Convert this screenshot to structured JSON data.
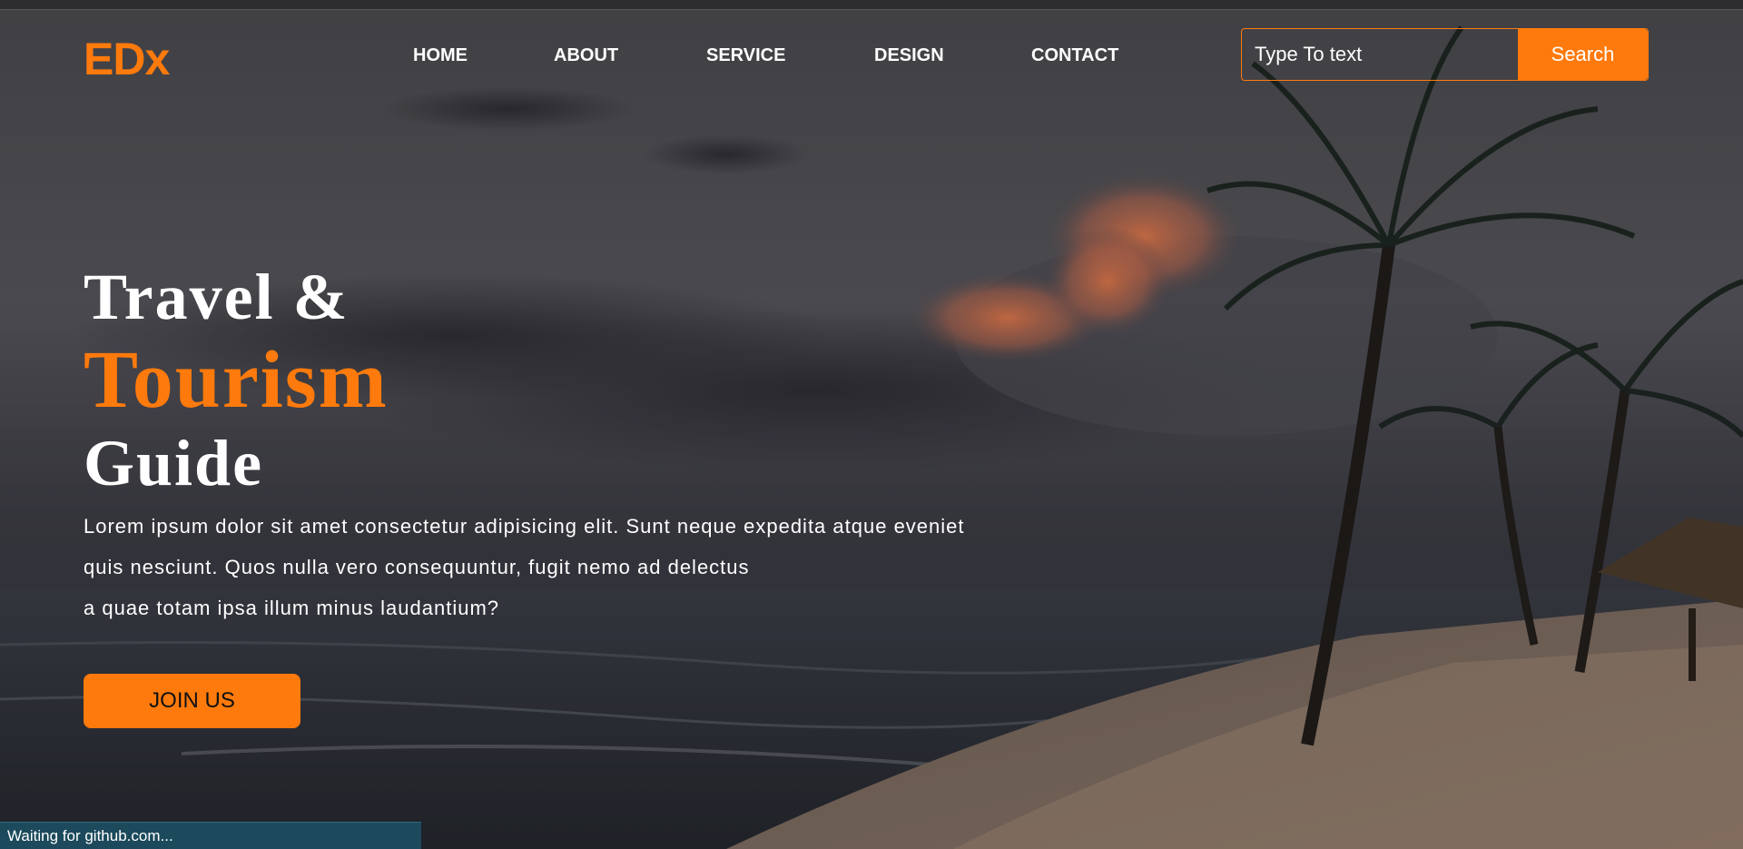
{
  "header": {
    "logo": "EDx",
    "nav": [
      {
        "label": "HOME"
      },
      {
        "label": "ABOUT"
      },
      {
        "label": "SERVICE"
      },
      {
        "label": "DESIGN"
      },
      {
        "label": "CONTACT"
      }
    ],
    "search": {
      "placeholder": "Type To text",
      "button_label": "Search"
    }
  },
  "hero": {
    "title_line1": "Travel &",
    "title_line2": "Tourism",
    "title_line3": "Guide",
    "description_lines": [
      "Lorem ipsum dolor sit amet consectetur adipisicing elit. Sunt neque expedita atque eveniet",
      "quis nesciunt. Quos nulla vero consequuntur, fugit nemo ad delectus",
      "a quae totam ipsa illum minus laudantium?"
    ],
    "cta_label": "JOIN US"
  },
  "status_bar": {
    "text": "Waiting for github.com..."
  },
  "colors": {
    "accent": "#ff7a0c",
    "text": "#ffffff",
    "status_bar": "#1c4a5c"
  }
}
